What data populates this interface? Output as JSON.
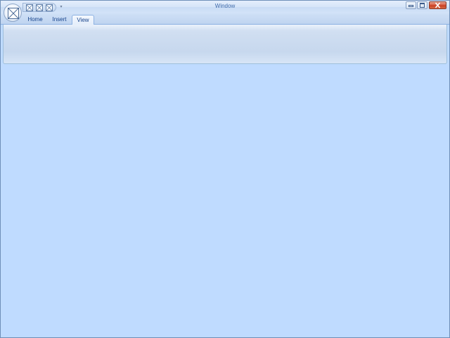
{
  "window": {
    "title": "Window"
  },
  "quick_access": {
    "buttons": [
      "placeholder-icon",
      "placeholder-icon",
      "placeholder-icon"
    ],
    "dropdown_glyph": "▾"
  },
  "window_controls": [
    "minimize",
    "maximize",
    "close"
  ],
  "ribbon": {
    "tabs": [
      {
        "label": "Home",
        "active": false
      },
      {
        "label": "Insert",
        "active": false
      },
      {
        "label": "View",
        "active": true
      }
    ]
  },
  "colors": {
    "content_background": "#bfdbff",
    "accent_text": "#15428b",
    "close_button": "#c63c20"
  }
}
